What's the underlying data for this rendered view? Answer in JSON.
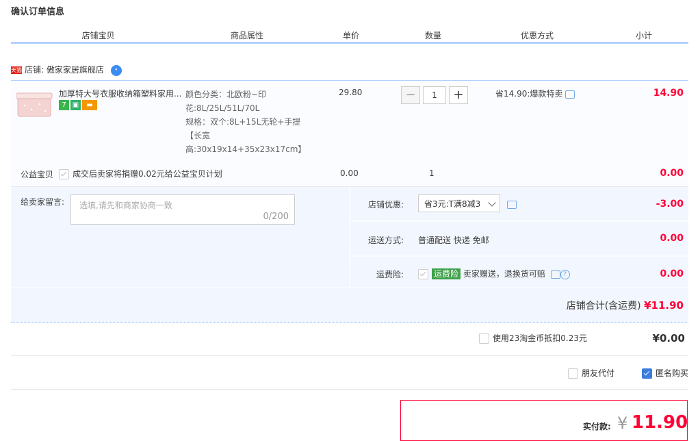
{
  "page": {
    "title": "确认订单信息"
  },
  "columns": [
    "店铺宝贝",
    "商品属性",
    "单价",
    "数量",
    "优惠方式",
    "小计"
  ],
  "shop": {
    "prefix": "店铺:",
    "name": "傲家家居旗舰店",
    "badge_text": "天猫"
  },
  "item": {
    "name": "加厚特大号衣服收纳箱塑料家用...",
    "attr_color": "颜色分类：北欧粉~印花:8L/25L/51L/70L",
    "attr_spec": "规格：双个:8L+15L无轮+手提【长宽高:30x19x14+35x23x17cm】",
    "price": "29.80",
    "quantity": "1",
    "qty_minus": "−",
    "qty_plus": "+",
    "promo": "省14.90:爆款特卖",
    "subtotal": "14.90"
  },
  "charity": {
    "label": "公益宝贝",
    "text": "成交后卖家将捐赠0.02元给公益宝贝计划",
    "price": "0.00",
    "qty": "1",
    "subtotal": "0.00"
  },
  "message": {
    "label": "给卖家留言:",
    "placeholder": "选填,请先和商家协商一致",
    "counter": "0/200"
  },
  "shop_discount": {
    "label": "店铺优惠:",
    "selected": "省3元:T满8减3",
    "value": "-3.00"
  },
  "shipping": {
    "label": "运送方式:",
    "text": "普通配送 快递 免邮",
    "value": "0.00"
  },
  "insurance": {
    "label": "运费险:",
    "tag": "运费险",
    "text": "卖家赠送，退换货可赔",
    "value": "0.00",
    "help": "?"
  },
  "shop_total": {
    "label": "店铺合计(含运费)",
    "value": "¥11.90"
  },
  "coins": {
    "text": "使用23淘金币抵扣0.23元",
    "value": "¥0.00"
  },
  "options": {
    "friend_pay": "朋友代付",
    "anonymous": "匿名购买"
  },
  "payment": {
    "label": "实付款:",
    "currency": "¥",
    "amount": "11.90"
  },
  "colors": {
    "accent_red": "#ff0036",
    "header_line": "#b2d1ff",
    "panel_bg": "#f2f7ff"
  }
}
